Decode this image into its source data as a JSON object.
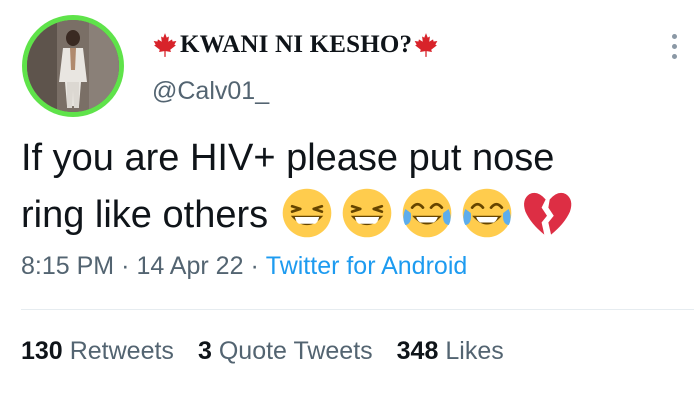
{
  "profile": {
    "display_name": "KWANI NI KESHO?",
    "handle": "@Calv01_",
    "name_emoji_left": "maple-leaf-icon",
    "name_emoji_right": "maple-leaf-icon"
  },
  "tweet": {
    "line1": "If you are HIV+ please put nose",
    "line2": "ring like others",
    "emojis": [
      "grinning-squinting-face-icon",
      "grinning-squinting-face-icon",
      "face-with-tears-of-joy-icon",
      "face-with-tears-of-joy-icon",
      "broken-heart-icon"
    ]
  },
  "meta": {
    "time": "8:15 PM",
    "date": "14 Apr 22",
    "separator": "·",
    "source": "Twitter for Android"
  },
  "stats": {
    "retweets_count": "130",
    "retweets_label": "Retweets",
    "quotes_count": "3",
    "quotes_label": "Quote Tweets",
    "likes_count": "348",
    "likes_label": "Likes"
  },
  "colors": {
    "text": "#0f1419",
    "secondary": "#536471",
    "link": "#1d9bf0",
    "avatar_ring": "#5fe34a",
    "maple_leaf": "#d8232a"
  }
}
